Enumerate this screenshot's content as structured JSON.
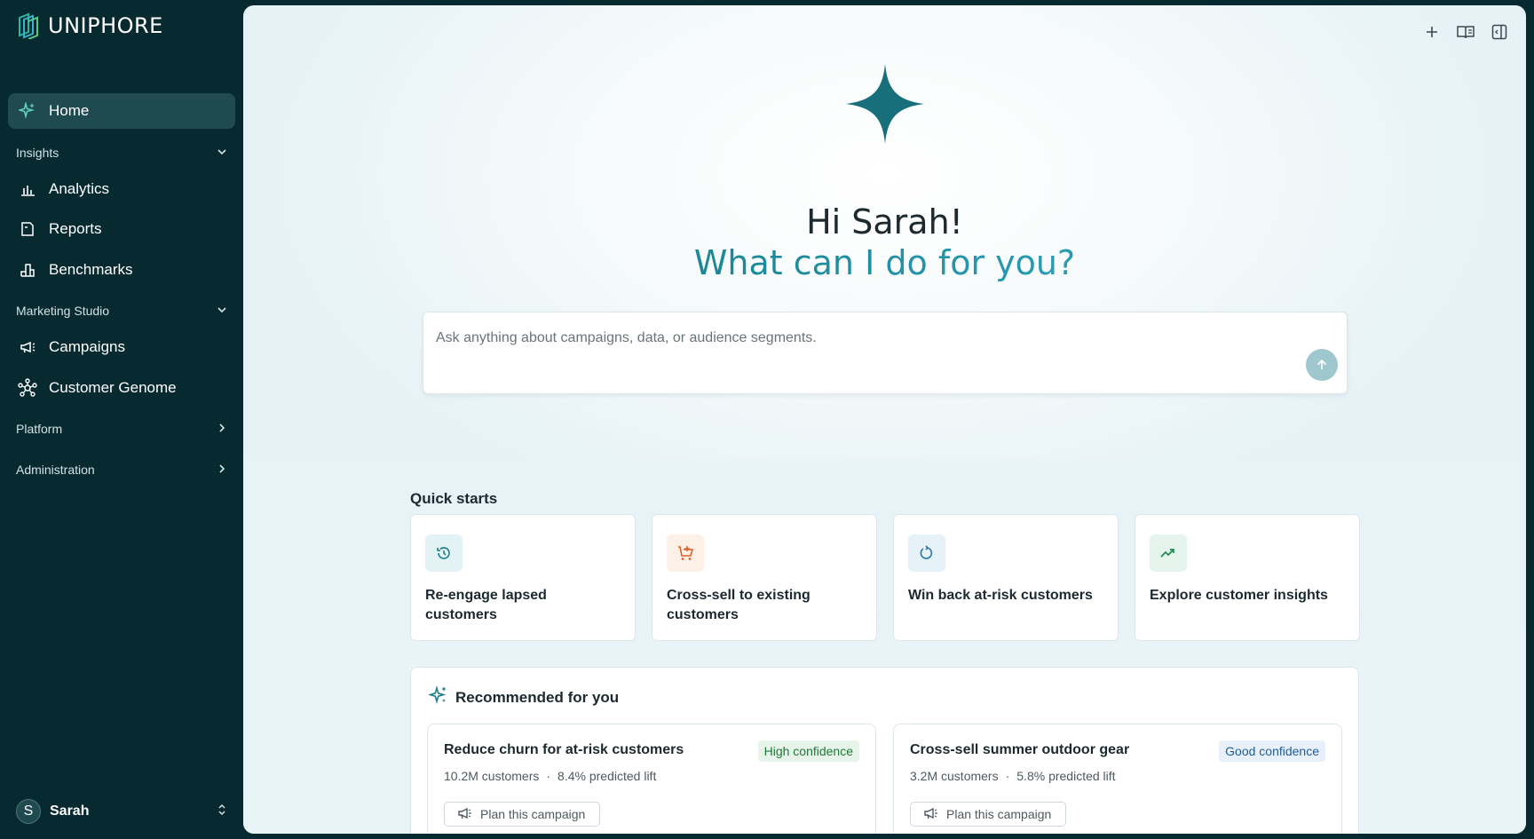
{
  "brand": {
    "name": "UNIPHORE"
  },
  "sidebar": {
    "home": {
      "label": "Home",
      "icon": "sparkle-icon"
    },
    "sections": [
      {
        "label": "Insights",
        "state": "expanded"
      },
      {
        "label": "Marketing Studio",
        "state": "expanded"
      },
      {
        "label": "Platform",
        "state": "collapsed"
      },
      {
        "label": "Administration",
        "state": "collapsed"
      }
    ],
    "items": [
      {
        "label": "Analytics",
        "icon": "bar-chart-icon"
      },
      {
        "label": "Reports",
        "icon": "report-icon"
      },
      {
        "label": "Benchmarks",
        "icon": "benchmark-icon"
      },
      {
        "label": "Campaigns",
        "icon": "megaphone-icon"
      },
      {
        "label": "Customer Genome",
        "icon": "network-icon"
      }
    ],
    "user": {
      "initial": "S",
      "name": "Sarah"
    }
  },
  "header": {
    "actions": [
      "plus-icon",
      "book-icon",
      "panel-toggle-icon"
    ]
  },
  "hero": {
    "greeting": "Hi Sarah!",
    "question": "What can I do for you?"
  },
  "prompt": {
    "placeholder": "Ask anything about campaigns, data, or audience segments."
  },
  "quick_starts": {
    "title": "Quick starts",
    "items": [
      {
        "label": "Re-engage lapsed customers",
        "icon": "history-icon",
        "color": "#1a7f8c",
        "bg": "#e3f2f4"
      },
      {
        "label": "Cross-sell to existing customers",
        "icon": "cart-icon",
        "color": "#d9622b",
        "bg": "#fdf0e7"
      },
      {
        "label": "Win back at-risk customers",
        "icon": "refresh-icon",
        "color": "#2177a8",
        "bg": "#e6f1f8"
      },
      {
        "label": "Explore customer insights",
        "icon": "trend-icon",
        "color": "#1f8a4f",
        "bg": "#e5f4ec"
      }
    ]
  },
  "recommended": {
    "title": "Recommended for you",
    "cards": [
      {
        "title": "Reduce churn for at-risk customers",
        "badge": "High confidence",
        "customers": "10.2M customers",
        "sep": "·",
        "lift": "8.4% predicted lift",
        "action": "Plan this campaign"
      },
      {
        "title": "Cross-sell summer outdoor gear",
        "badge": "Good confidence",
        "customers": "3.2M customers",
        "sep": "·",
        "lift": "5.8% predicted lift",
        "action": "Plan this campaign"
      }
    ]
  },
  "colors": {
    "sidebar_bg": "#072a30",
    "accent": "#1a7f8c",
    "accent_light": "#3db4d6"
  }
}
